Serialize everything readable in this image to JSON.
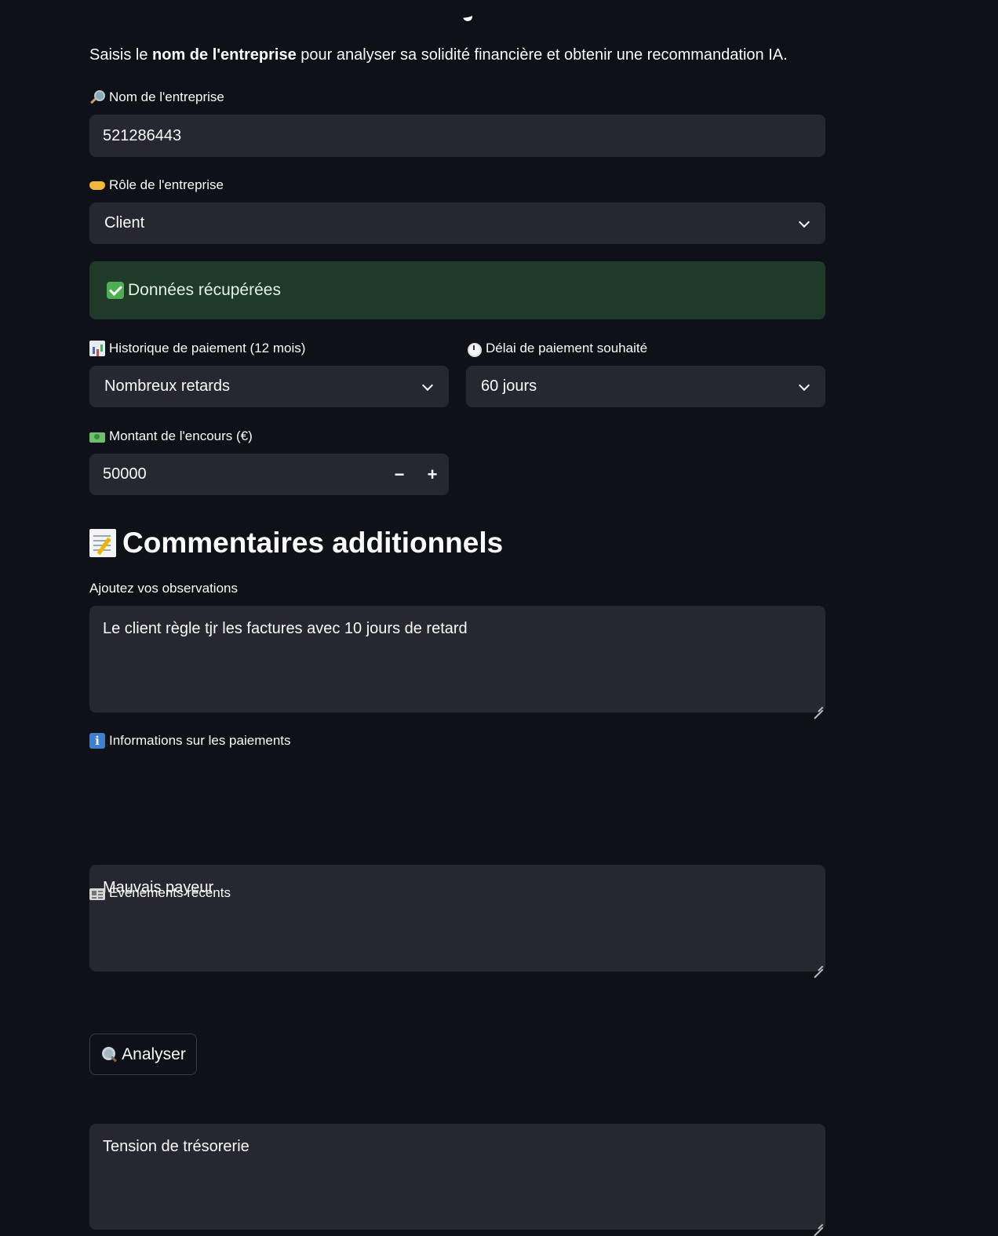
{
  "intro": {
    "prefix": "Saisis le ",
    "bold": "nom de l'entreprise",
    "suffix": " pour analyser sa solidité financière et obtenir une recommandation IA."
  },
  "company": {
    "label": "Nom de l'entreprise",
    "value": "521286443"
  },
  "role": {
    "label": "Rôle de l'entreprise",
    "selected": "Client"
  },
  "status": {
    "message": "Données récupérées"
  },
  "history": {
    "label": "Historique de paiement (12 mois)",
    "selected": "Nombreux retards"
  },
  "delay": {
    "label": "Délai de paiement souhaité",
    "selected": "60 jours"
  },
  "amount": {
    "label": "Montant de l'encours (€)",
    "value": "50000",
    "decrement": "−",
    "increment": "+"
  },
  "comments": {
    "heading": "Commentaires additionnels",
    "observations_label": "Ajoutez vos observations",
    "observations_value": "Le client règle tjr les factures avec 10 jours de retard",
    "payments_label": "Informations sur les paiements",
    "payments_value": "Mauvais payeur",
    "events_label": "Événements récents",
    "events_value": "Tension de trésorerie"
  },
  "analyze_button": {
    "label": "Analyser"
  }
}
